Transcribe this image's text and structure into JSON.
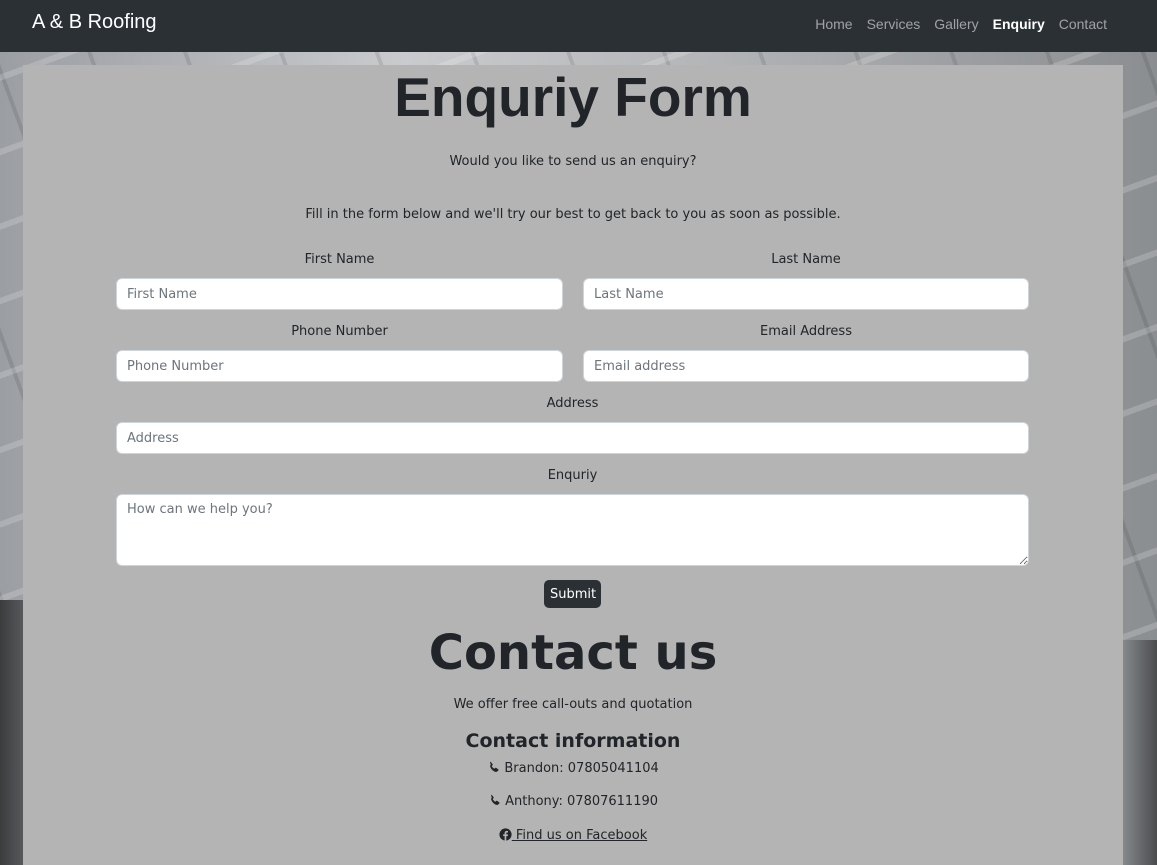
{
  "navbar": {
    "brand": "A & B Roofing",
    "links": [
      {
        "label": "Home",
        "active": false
      },
      {
        "label": "Services",
        "active": false
      },
      {
        "label": "Gallery",
        "active": false
      },
      {
        "label": "Enquiry",
        "active": true
      },
      {
        "label": "Contact",
        "active": false
      }
    ]
  },
  "form": {
    "title": "Enquriy Form",
    "intro": "Would you like to send us an enquiry?",
    "instructions": "Fill in the form below and we'll try our best to get back to you as soon as possible.",
    "first_name": {
      "label": "First Name",
      "placeholder": "First Name",
      "value": ""
    },
    "last_name": {
      "label": "Last Name",
      "placeholder": "Last Name",
      "value": ""
    },
    "phone": {
      "label": "Phone Number",
      "placeholder": "Phone Number",
      "value": ""
    },
    "email": {
      "label": "Email Address",
      "placeholder": "Email address",
      "value": ""
    },
    "address": {
      "label": "Address",
      "placeholder": "Address",
      "value": ""
    },
    "enquiry": {
      "label": "Enquriy",
      "placeholder": "How can we help you?",
      "value": ""
    },
    "submit_label": "Submit"
  },
  "contact": {
    "title": "Contact us",
    "subtitle": "We offer free call-outs and quotation",
    "info_title": "Contact information",
    "phones": [
      {
        "text": "Brandon: 07805041104",
        "icon": "phone-icon"
      },
      {
        "text": "Anthony: 07807611190",
        "icon": "phone-icon"
      }
    ],
    "facebook": {
      "text": " Find us on Facebook",
      "icon": "facebook-icon"
    }
  },
  "colors": {
    "navbar_bg": "#2b3035",
    "panel_bg": "#b4b4b4",
    "text": "#212529",
    "button_bg": "#2b3035"
  }
}
